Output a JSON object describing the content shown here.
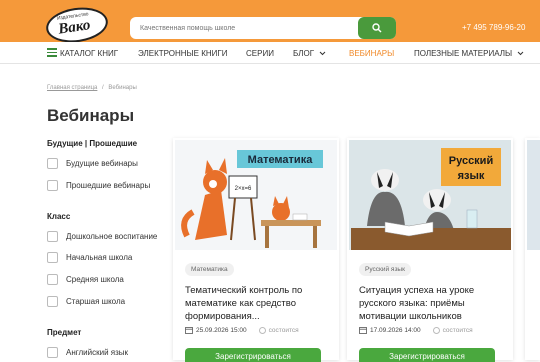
{
  "header": {
    "logo_top": "Издательство",
    "logo_name": "Вако",
    "search_placeholder": "Качественная помощь школе",
    "phone": "+7 495 789-96-20"
  },
  "nav": {
    "items": [
      {
        "label": "КАТАЛОГ КНИГ"
      },
      {
        "label": "ЭЛЕКТРОННЫЕ КНИГИ"
      },
      {
        "label": "СЕРИИ"
      },
      {
        "label": "БЛОГ"
      },
      {
        "label": "ВЕБИНАРЫ"
      },
      {
        "label": "ПОЛЕЗНЫЕ МАТЕРИАЛЫ"
      }
    ]
  },
  "breadcrumb": {
    "home": "Главная страница",
    "sep": "/",
    "current": "Вебинары"
  },
  "page_title": "Вебинары",
  "filters": {
    "time": {
      "heading": "Будущие | Прошедшие",
      "options": [
        "Будущие вебинары",
        "Прошедшие вебинары"
      ]
    },
    "class": {
      "heading": "Класс",
      "options": [
        "Дошкольное воспитание",
        "Начальная школа",
        "Средняя школа",
        "Старшая школа"
      ]
    },
    "subject": {
      "heading": "Предмет",
      "options": [
        "Английский язык"
      ]
    }
  },
  "cards": [
    {
      "image_label": "Математика",
      "formula": "2×x=6",
      "tag": "Математика",
      "title": "Тематический контроль по математике как средство формирования...",
      "date": "25.09.2026 15:00",
      "status": "состоится",
      "button": "Зарегистрироваться"
    },
    {
      "image_label_line1": "Русский",
      "image_label_line2": "язык",
      "tag": "Русский язык",
      "title": "Ситуация успеха на уроке русского языка: приёмы мотивации школьников",
      "date": "17.09.2026 14:00",
      "status": "состоится",
      "button": "Зарегистрироваться"
    }
  ],
  "colors": {
    "header": "#f5993a",
    "accent_green": "#4aa83e",
    "nav_active": "#f08a2a"
  }
}
